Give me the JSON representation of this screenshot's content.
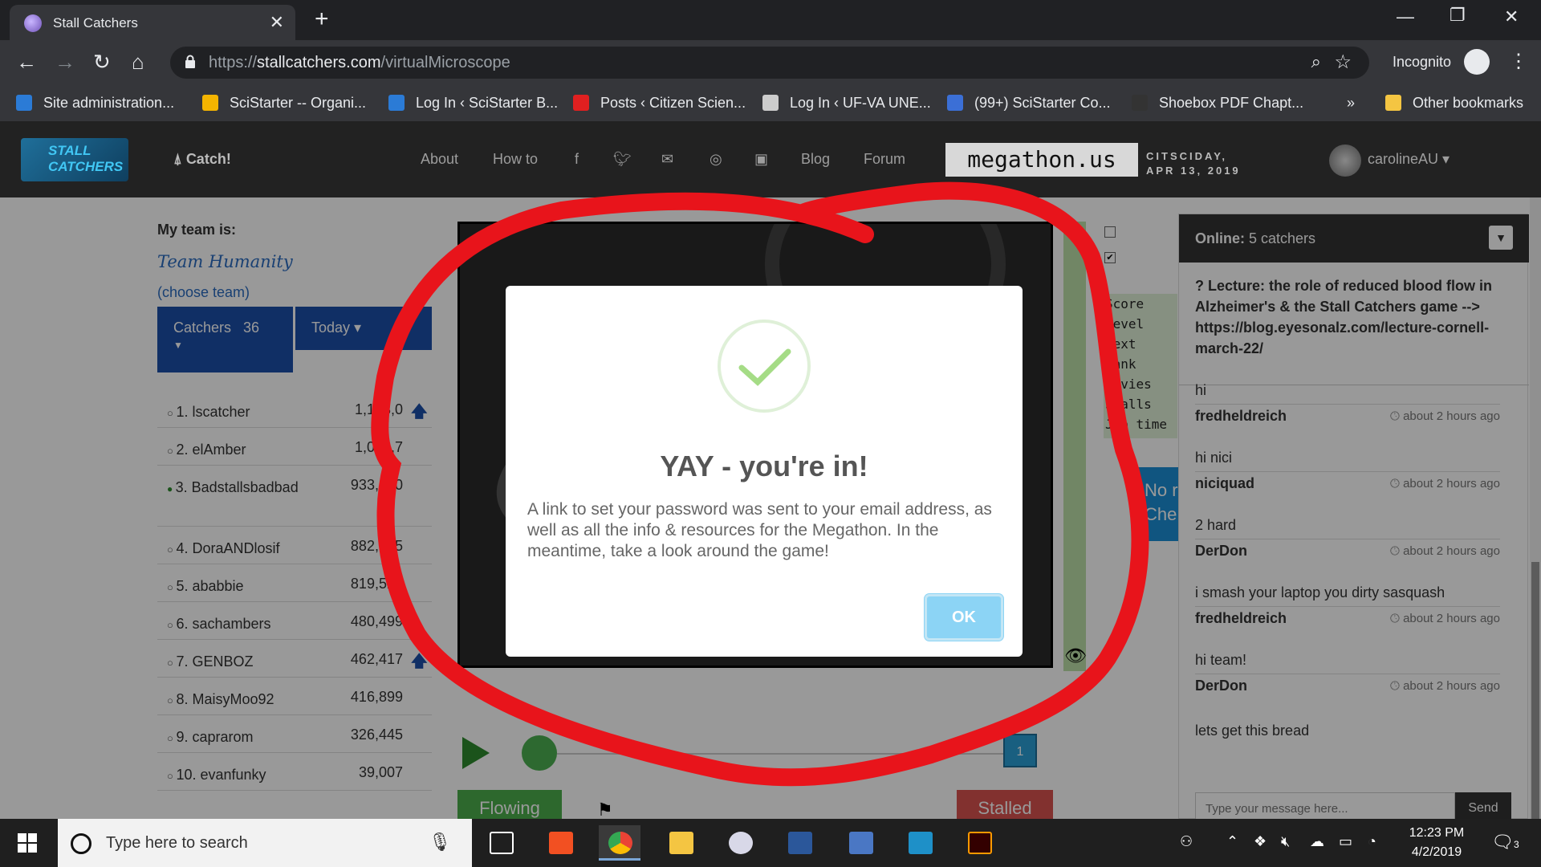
{
  "browser": {
    "tab_title": "Stall Catchers",
    "url_scheme": "https://",
    "url_host": "stallcatchers.com",
    "url_path": "/virtualMicroscope",
    "incognito_label": "Incognito",
    "bookmarks": [
      {
        "label": "Site administration...",
        "icon": "moodle-icon",
        "color": "#2b7bd6"
      },
      {
        "label": "SciStarter -- Organi...",
        "icon": "drive-icon",
        "color": "#f4b400"
      },
      {
        "label": "Log In ‹ SciStarter B...",
        "icon": "site-icon",
        "color": "#2b7bd6"
      },
      {
        "label": "Posts ‹ Citizen Scien...",
        "icon": "d-icon",
        "color": "#e02020"
      },
      {
        "label": "Log In ‹ UF-VA UNE...",
        "icon": "page-icon",
        "color": "#cccccc"
      },
      {
        "label": "(99+) SciStarter Co...",
        "icon": "chat-icon",
        "color": "#3b6fd6"
      },
      {
        "label": "Shoebox PDF Chapt...",
        "icon": "moon-icon",
        "color": "#333333"
      }
    ],
    "bookmarks_overflow": "»",
    "other_bookmarks": "Other bookmarks"
  },
  "site": {
    "logo_text": "STALL CATCHERS",
    "catch_label": "Catch!",
    "nav": [
      "About",
      "How to",
      "Blog",
      "Forum"
    ],
    "megathon_label": "megathon.us",
    "citsciday_line1": "CITSCIDAY,",
    "citsciday_line2": "APR 13, 2019",
    "username": "carolineAU"
  },
  "team": {
    "my_team_label": "My team is:",
    "team_name": "Team Humanity",
    "choose_team": "(choose team)",
    "catchers_label": "Catchers",
    "catchers_count": "36",
    "today_label": "Today"
  },
  "leaderboard": [
    {
      "name": "1. lscatcher",
      "score": "1,183,0",
      "up": true,
      "online": false
    },
    {
      "name": "2. elAmber",
      "score": "1,039,7",
      "up": false,
      "online": false
    },
    {
      "name": "3. Badstallsbadbad",
      "score": "933,220",
      "up": false,
      "online": true
    },
    {
      "name": "4. DoraANDlosif",
      "score": "882,525",
      "up": false,
      "online": false
    },
    {
      "name": "5. ababbie",
      "score": "819,525",
      "up": false,
      "online": false
    },
    {
      "name": "6. sachambers",
      "score": "480,499",
      "up": false,
      "online": false
    },
    {
      "name": "7. GENBOZ",
      "score": "462,417",
      "up": true,
      "online": false
    },
    {
      "name": "8. MaisyMoo92",
      "score": "416,899",
      "up": false,
      "online": false
    },
    {
      "name": "9. caprarom",
      "score": "326,445",
      "up": false,
      "online": false
    },
    {
      "name": "10. evanfunky",
      "score": "39,007",
      "up": false,
      "online": false
    }
  ],
  "game": {
    "stats_lines": [
      "Score",
      "Level",
      "Next",
      "Rank",
      "Movies",
      "Stalls",
      "Job time"
    ],
    "no_check_label": "No r Che",
    "frame_number": "1",
    "flowing_label": "Flowing",
    "stalled_label": "Stalled"
  },
  "chat": {
    "online_label": "Online:",
    "online_count": "5 catchers",
    "notice": "? Lecture: the role of reduced blood flow in Alzheimer's & the Stall Catchers game --> https://blog.eyesonalz.com/lecture-cornell-march-22/",
    "messages": [
      {
        "text": "hi",
        "author": "fredheldreich",
        "time": "about 2 hours ago"
      },
      {
        "text": "hi nici",
        "author": "niciquad",
        "time": "about 2 hours ago"
      },
      {
        "text": "2 hard",
        "author": "DerDon",
        "time": "about 2 hours ago"
      },
      {
        "text": "i smash your laptop you dirty sasquash",
        "author": "fredheldreich",
        "time": "about 2 hours ago"
      },
      {
        "text": "hi team!",
        "author": "DerDon",
        "time": "about 2 hours ago"
      }
    ],
    "last_message": "lets get this bread",
    "input_placeholder": "Type your message here...",
    "send_label": "Send"
  },
  "modal": {
    "title": "YAY - you're in!",
    "text": "A link to set your password was sent to your email address, as well as all the info & resources for the Megathon. In the meantime, take a look around the game!",
    "ok_label": "OK"
  },
  "taskbar": {
    "search_placeholder": "Type here to search",
    "time": "12:23 PM",
    "date": "4/2/2019",
    "notification_count": "3"
  },
  "colors": {
    "annotation_red": "#e8141b",
    "chrome_dark": "#35363a",
    "site_header": "#222222",
    "team_blue": "#1c4fa8",
    "ok_button": "#8cd4f5",
    "check_green": "#a5dc86"
  }
}
